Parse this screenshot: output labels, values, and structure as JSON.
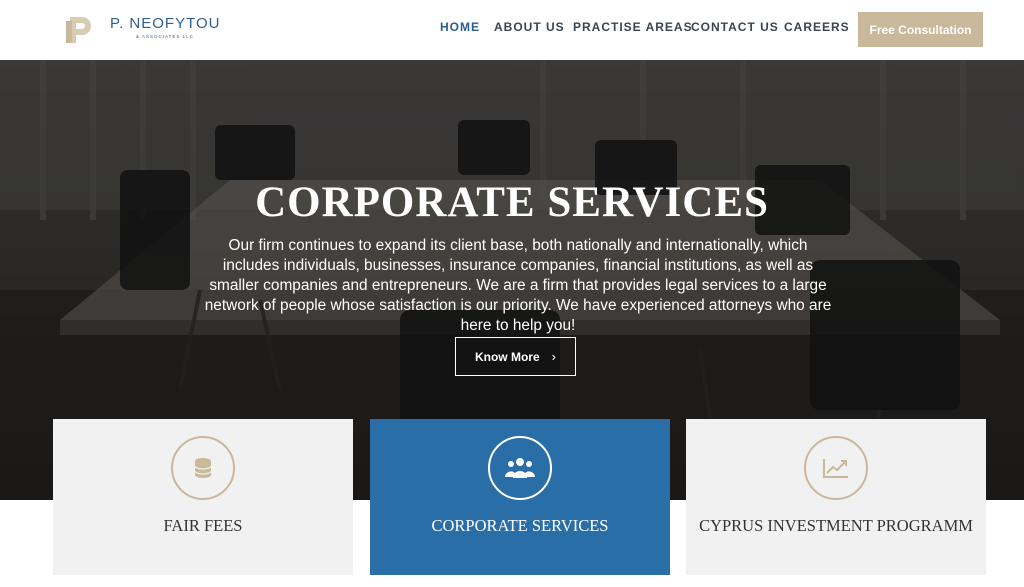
{
  "brand": {
    "name": "P. NEOFYTOU",
    "sub": "& ASSOCIATES LLC",
    "logo_icon": "p-monogram-logo"
  },
  "nav": {
    "items": [
      {
        "label": "HOME",
        "active": true
      },
      {
        "label": "ABOUT US",
        "active": false
      },
      {
        "label": "PRACTISE AREAS",
        "active": false
      },
      {
        "label": "CONTACT US",
        "active": false
      },
      {
        "label": "CAREERS",
        "active": false
      }
    ],
    "cta_label": "Free Consultation"
  },
  "hero": {
    "title": "CORPORATE SERVICES",
    "text": "Our firm continues to expand its client base, both nationally and internationally, which includes individuals, businesses, insurance companies, financial institutions, as well as smaller companies and entrepreneurs. We are a firm that provides legal services to a large network of people whose satisfaction is our priority. We have experienced attorneys who are here to help you!",
    "button_label": "Know More",
    "button_icon": "chevron-right-icon"
  },
  "cards": [
    {
      "label": "FAIR FEES",
      "icon": "coins-stack-icon",
      "active": false
    },
    {
      "label": "CORPORATE SERVICES",
      "icon": "people-group-icon",
      "active": true
    },
    {
      "label": "CYPRUS INVESTMENT PROGRAMM",
      "icon": "line-chart-icon",
      "active": false
    }
  ],
  "colors": {
    "brand_blue": "#2a5e8e",
    "gold": "#c9b89a",
    "active_card": "#2a6ea8",
    "card_bg": "#f1f1f1"
  }
}
